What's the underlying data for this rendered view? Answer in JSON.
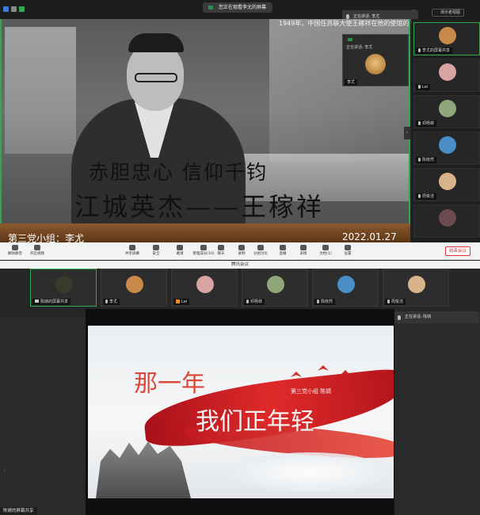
{
  "meeting_top": {
    "share_pill": "您正在观看李尤的屏幕",
    "speaker": "正在讲话: 李尤",
    "view_button": "演示者视图",
    "slide_caption": "1949年，中国任苏联大使王稼祥在他的使馆的办公",
    "slide_line1": "赤胆忠心  信仰千钧",
    "slide_line2": "江城英杰——王稼祥",
    "slide_footer_left": "第三党小组：李尤",
    "slide_footer_right": "2022.01.27",
    "float_label": "正在讲话: 李尤",
    "float_name": "李尤",
    "side_participants": [
      {
        "name": "李尤的屏幕共享",
        "color": "#c8894a"
      },
      {
        "name": "Lei",
        "color": "#d8a3a0"
      },
      {
        "name": "邓杨菲",
        "color": "#8fa77a"
      },
      {
        "name": "陈晓然",
        "color": "#4a8ec8"
      },
      {
        "name": "周俊洁",
        "color": "#d9b38a"
      },
      {
        "name": "",
        "color": "#6b4a50"
      }
    ],
    "toolbar": [
      {
        "label": "解除静音",
        "icon": "mic-icon"
      },
      {
        "label": "开启视频",
        "icon": "camera-icon"
      },
      {
        "label": "共享屏幕",
        "icon": "share-screen-icon"
      },
      {
        "label": "安全",
        "icon": "shield-icon"
      },
      {
        "label": "邀请",
        "icon": "invite-icon"
      },
      {
        "label": "管理成员(10)",
        "icon": "members-icon"
      },
      {
        "label": "聊天",
        "icon": "chat-icon"
      },
      {
        "label": "录制",
        "icon": "record-icon"
      },
      {
        "label": "分组讨论",
        "icon": "breakout-icon"
      },
      {
        "label": "直播",
        "icon": "live-icon"
      },
      {
        "label": "表情",
        "icon": "emoji-icon"
      },
      {
        "label": "文档(1)",
        "icon": "document-icon"
      },
      {
        "label": "设置",
        "icon": "gear-icon"
      }
    ],
    "end_button": "结束会议"
  },
  "meeting_bottom": {
    "app_title": "腾讯会议",
    "speaker": "正在讲话: 陈婧",
    "strip": [
      {
        "name": "陈婧的屏幕共享",
        "color": "#3a3a2a",
        "active": true
      },
      {
        "name": "李尤",
        "color": "#c8894a",
        "active": false
      },
      {
        "name": "Lei",
        "color": "#d8a3a0",
        "active": false
      },
      {
        "name": "邓杨菲",
        "color": "#8fa77a",
        "active": false
      },
      {
        "name": "陈晓然",
        "color": "#4a8ec8",
        "active": false
      },
      {
        "name": "周俊洁",
        "color": "#d9b38a",
        "active": false
      }
    ],
    "slide_title_a": "那一年",
    "slide_title_b": "我们正年轻",
    "slide_subtitle": "第三党小组 陈婧",
    "share_tag": "陈婧的屏幕共享"
  },
  "colors": {
    "accent_green": "#2fa84f",
    "end_red": "#d33333"
  }
}
